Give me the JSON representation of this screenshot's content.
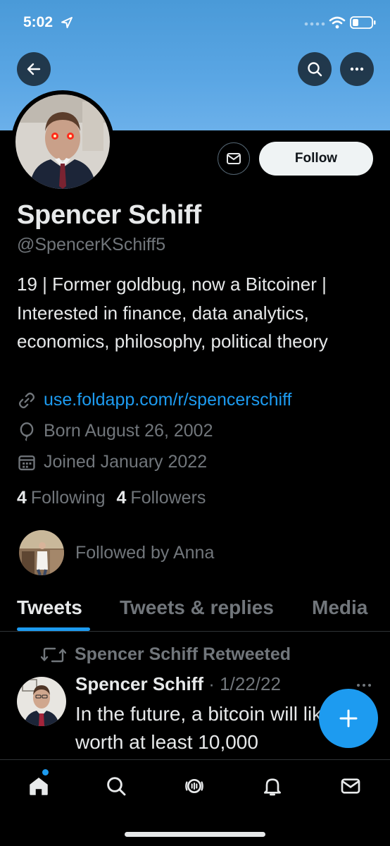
{
  "status_bar": {
    "time": "5:02"
  },
  "profile": {
    "name": "Spencer Schiff",
    "handle": "@SpencerKSchiff5",
    "bio": "19 | Former goldbug, now a Bitcoiner | Interested in finance, data analytics, economics, philosophy, political theory",
    "link": "use.foldapp.com/r/spencerschiff",
    "born": "Born August 26, 2002",
    "joined": "Joined January 2022",
    "following_count": "4",
    "following_label": "Following",
    "followers_count": "4",
    "followers_label": "Followers",
    "followed_by": "Followed by Anna"
  },
  "actions": {
    "follow_label": "Follow"
  },
  "tabs": [
    {
      "label": "Tweets",
      "active": true
    },
    {
      "label": "Tweets & replies",
      "active": false
    },
    {
      "label": "Media",
      "active": false
    }
  ],
  "tweet": {
    "retweet_label": "Spencer Schiff Retweeted",
    "author": "Spencer Schiff",
    "separator": " · ",
    "date": "1/22/22",
    "text": "In the future, a bitcoin will likely be worth at least 10,000"
  },
  "colors": {
    "accent": "#1d9bf0",
    "background": "#000000",
    "banner": "#5aa6e4",
    "muted_text": "#71767b"
  },
  "icons": {
    "back": "arrow-left-icon",
    "search": "search-icon",
    "more": "more-horizontal-icon",
    "message": "envelope-icon",
    "link": "link-icon",
    "born": "balloon-icon",
    "joined": "calendar-icon",
    "retweet": "retweet-icon",
    "compose": "plus-icon",
    "nav": [
      "home-icon",
      "search-icon",
      "spaces-icon",
      "bell-icon",
      "envelope-icon"
    ]
  }
}
